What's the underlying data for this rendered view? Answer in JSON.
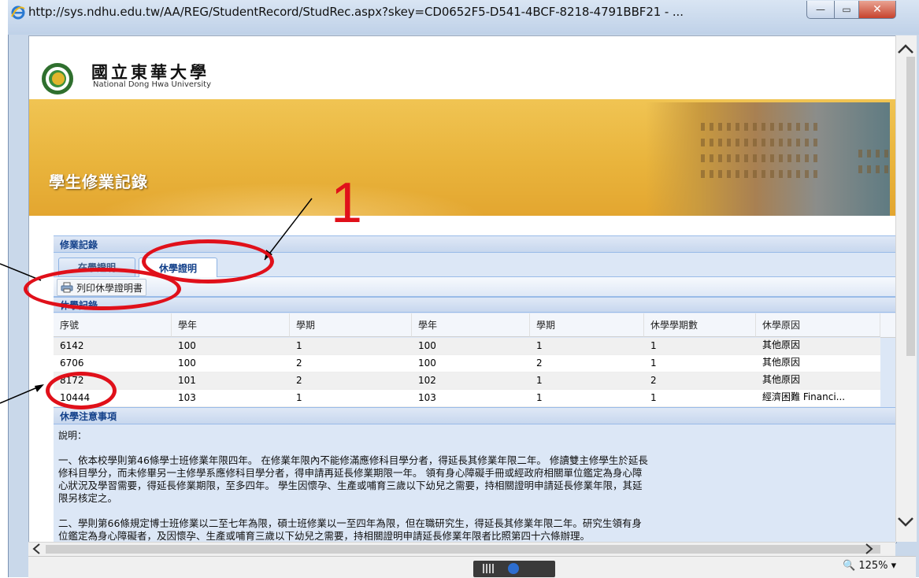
{
  "window": {
    "url": "http://sys.ndhu.edu.tw/AA/REG/StudentRecord/StudRec.aspx?skey=CD0652F5-D541-4BCF-8218-4791BBF21 - ...",
    "min": "—",
    "max": "▭",
    "close": "✕"
  },
  "header": {
    "university_cn": "國立東華大學",
    "university_en": "National Dong Hwa University",
    "page_title": "學生修業記錄"
  },
  "panel": {
    "title": "修業記錄",
    "tabs": [
      {
        "label": "在學證明"
      },
      {
        "label": "休學證明"
      }
    ],
    "print_button": "列印休學證明書",
    "suspension_title": "休學記錄",
    "columns": [
      "序號",
      "學年",
      "學期",
      "學年",
      "學期",
      "休學學期數",
      "休學原因"
    ],
    "rows": [
      [
        "6142",
        "100",
        "1",
        "100",
        "1",
        "1",
        "其他原因"
      ],
      [
        "6706",
        "100",
        "2",
        "100",
        "2",
        "1",
        "其他原因"
      ],
      [
        "8172",
        "101",
        "2",
        "102",
        "1",
        "2",
        "其他原因"
      ],
      [
        "10444",
        "103",
        "1",
        "103",
        "1",
        "1",
        "經濟困難 Financi..."
      ]
    ],
    "notes_title": "休學注意事項",
    "notes_label": "說明：",
    "note1": "一、依本校學則第46條學士班修業年限四年。 在修業年限內不能修滿應修科目學分者，得延長其修業年限二年。 修讀雙主修學生於延長\n修科目學分，而未修畢另一主修學系應修科目學分者，得申請再延長修業期限一年。 領有身心障礙手冊或經政府相關單位鑑定為身心障\n心狀況及學習需要，得延長修業期限，至多四年。 學生因懷孕、生產或哺育三歲以下幼兒之需要，持相關證明申請延長修業年限，其延\n限另核定之。",
    "note2": "二、學則第66條規定博士班修業以二至七年為限，碩士班修業以一至四年為限，但在職研究生，得延長其修業年限二年。研究生領有身\n位鑑定為身心障礙者，及因懷孕、生產或哺育三歲以下幼兒之需要，持相關證明申請延長修業年限者比照第四十六條辦理。"
  },
  "annotation": {
    "number": "1",
    "color": "#e0101a"
  },
  "status": {
    "zoom": "🔍 125%  ▾"
  }
}
